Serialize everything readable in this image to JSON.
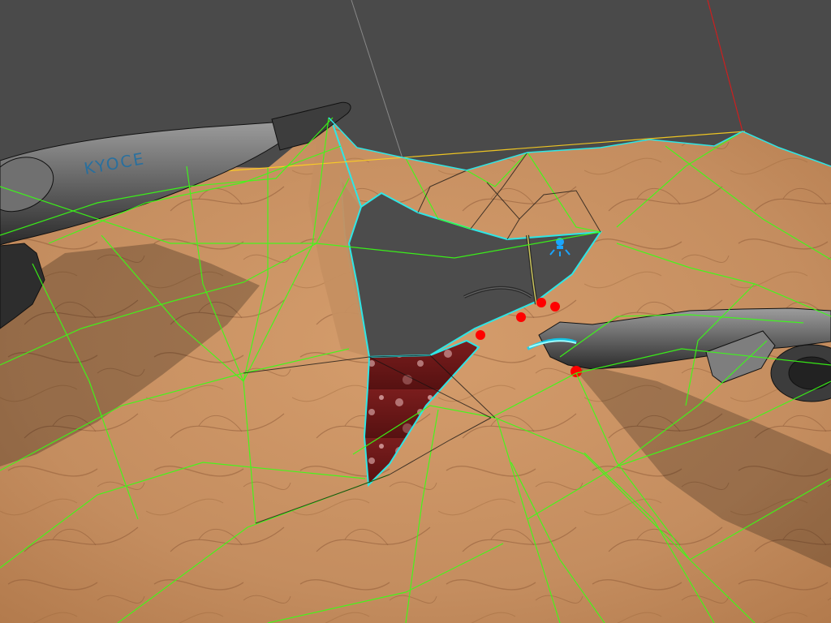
{
  "viewport": {
    "background_color": "#4a4a4a",
    "skin_color": "#c48d5f",
    "skin_shadow_color": "#8c5a35",
    "mesh_color": "#39ff14",
    "edge_color": "#2ee6e6",
    "axis_x_color": "#cc1f1f",
    "axis_y_color": "#9a9a9a",
    "wound_color": "#6b1515",
    "control_point_color": "#ff0000",
    "horizon_line_color": "#ffd21f"
  },
  "instruments": {
    "left_tool": {
      "name": "surgical-forceps",
      "label_text": "KYOCE"
    },
    "right_tool": {
      "name": "needle-holder"
    },
    "suture": {
      "name": "suture-needle"
    }
  },
  "light_marker": {
    "icon": "light-bulb-icon",
    "color": "#1aa5ff"
  }
}
